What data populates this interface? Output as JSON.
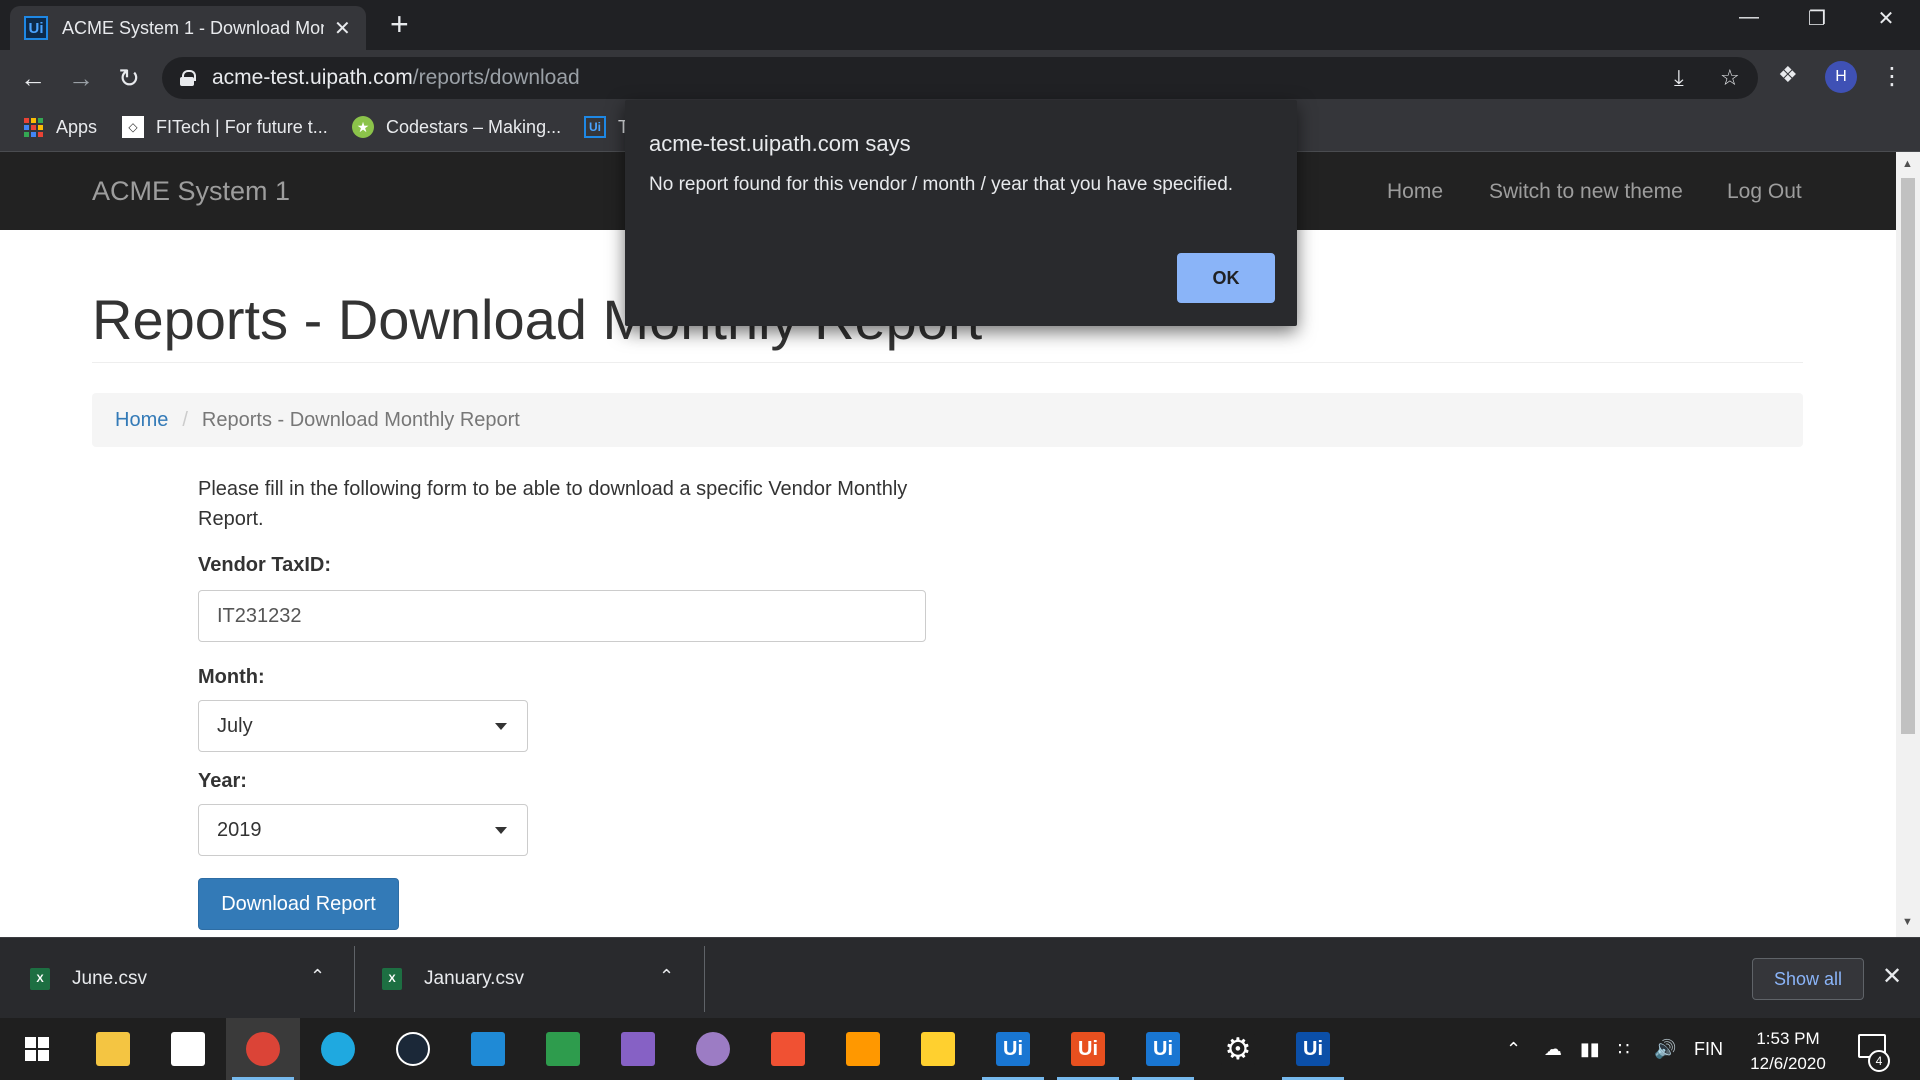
{
  "browser": {
    "tab_title": "ACME System 1 - Download Mon",
    "tab_favicon_text": "Ui",
    "tab_close": "✕",
    "new_tab": "+",
    "url_host": "acme-test.uipath.com",
    "url_path": "/reports/download",
    "profile_initial": "H",
    "bookmarks": [
      {
        "label": "Apps",
        "icon": "apps-grid-icon"
      },
      {
        "label": "FITech | For future t...",
        "icon": "fitech-icon"
      },
      {
        "label": "Codestars – Making...",
        "icon": "codestars-icon"
      },
      {
        "label": "T",
        "icon": "uipath-icon"
      }
    ]
  },
  "site": {
    "brand": "ACME System 1",
    "nav": {
      "home": "Home",
      "switch_theme": "Switch to new theme",
      "logout": "Log Out"
    },
    "page_title": "Reports - Download Monthly Report",
    "breadcrumb": {
      "home": "Home",
      "separator": "/",
      "current": "Reports - Download Monthly Report"
    },
    "intro": "Please fill in the following form to be able to download a specific Vendor Monthly Report.",
    "form": {
      "taxid_label": "Vendor TaxID:",
      "taxid_value": "IT231232",
      "month_label": "Month:",
      "month_value": "July",
      "year_label": "Year:",
      "year_value": "2019",
      "submit_label": "Download Report"
    }
  },
  "dialog": {
    "title": "acme-test.uipath.com says",
    "message": "No report found for this vendor / month / year that you have specified.",
    "ok_label": "OK"
  },
  "downloads": {
    "items": [
      {
        "name": "June.csv",
        "icon_text": "X"
      },
      {
        "name": "January.csv",
        "icon_text": "X"
      }
    ],
    "show_all": "Show all",
    "close": "✕"
  },
  "taskbar": {
    "apps": [
      {
        "name": "file-explorer-icon",
        "glyph": "",
        "color": "#f4c542"
      },
      {
        "name": "store-icon",
        "glyph": "",
        "color": "#ffffff"
      },
      {
        "name": "chrome-icon",
        "glyph": "",
        "color": "#db4437"
      },
      {
        "name": "edge-icon",
        "glyph": "",
        "color": "#1fa9e0"
      },
      {
        "name": "steam-icon",
        "glyph": "",
        "color": "#ffffff"
      },
      {
        "name": "mail-icon",
        "glyph": "",
        "color": "#1f8ad6"
      },
      {
        "name": "xml-tool-icon",
        "glyph": "",
        "color": "#2e9c4d"
      },
      {
        "name": "visual-studio-icon",
        "glyph": "",
        "color": "#8661c5"
      },
      {
        "name": "github-icon",
        "glyph": "",
        "color": "#9c7cc4"
      },
      {
        "name": "git-icon",
        "glyph": "",
        "color": "#f05133"
      },
      {
        "name": "sublime-icon",
        "glyph": "",
        "color": "#ff9800"
      },
      {
        "name": "miro-icon",
        "glyph": "",
        "color": "#ffd02f"
      },
      {
        "name": "uipath-studio-icon",
        "glyph": "Ui",
        "color": "#1976d2"
      },
      {
        "name": "uipath-orchestrator-icon",
        "glyph": "Ui",
        "color": "#e8501f"
      },
      {
        "name": "uipath-assistant-icon",
        "glyph": "Ui",
        "color": "#1976d2"
      },
      {
        "name": "settings-icon",
        "glyph": "⚙",
        "color": "#1f1f1f"
      },
      {
        "name": "uipath-robot-icon",
        "glyph": "Ui",
        "color": "#0b4fa8"
      }
    ],
    "language": "FIN",
    "time": "1:53 PM",
    "date": "12/6/2020",
    "notification_count": "4"
  }
}
